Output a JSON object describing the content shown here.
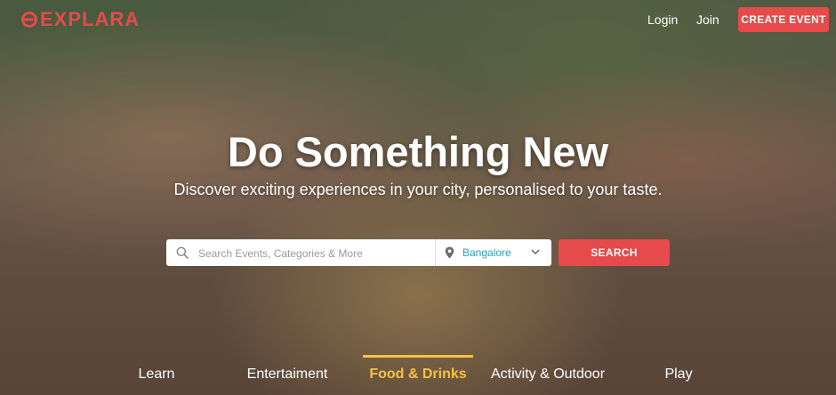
{
  "brand": {
    "name": "EXPLARA",
    "color": "#e64a4a"
  },
  "nav": {
    "login": "Login",
    "join": "Join",
    "create_event": "CREATE EVENT"
  },
  "hero": {
    "title": "Do Something New",
    "subtitle": "Discover exciting experiences in your city, personalised to your taste."
  },
  "search": {
    "placeholder": "Search Events, Categories & More",
    "value": "",
    "city": "Bangalore",
    "button": "SEARCH",
    "icons": {
      "search": "search-icon",
      "location": "map-pin-icon",
      "dropdown": "chevron-down-icon"
    }
  },
  "tabs": [
    {
      "label": "Learn",
      "active": false
    },
    {
      "label": "Entertaiment",
      "active": false
    },
    {
      "label": "Food & Drinks",
      "active": true
    },
    {
      "label": "Activity & Outdoor",
      "active": false
    },
    {
      "label": "Play",
      "active": false
    }
  ],
  "colors": {
    "accent": "#e64a4a",
    "active_tab": "#f5c242",
    "city_text": "#2a9fb8"
  }
}
